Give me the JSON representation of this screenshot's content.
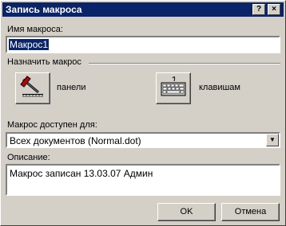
{
  "window": {
    "title": "Запись макроса",
    "help_button": "?",
    "close_button": "×"
  },
  "macro_name": {
    "label": "Имя макроса:",
    "value": "Макрос1"
  },
  "assign": {
    "group_label": "Назначить макрос",
    "toolbars_label": "панели",
    "keyboard_label": "клавишам"
  },
  "store_in": {
    "label": "Макрос доступен для:",
    "value": "Всех документов (Normal.dot)"
  },
  "description": {
    "label": "Описание:",
    "value": "Макрос записан 13.03.07 Админ"
  },
  "buttons": {
    "ok": "OK",
    "cancel": "Отмена"
  }
}
